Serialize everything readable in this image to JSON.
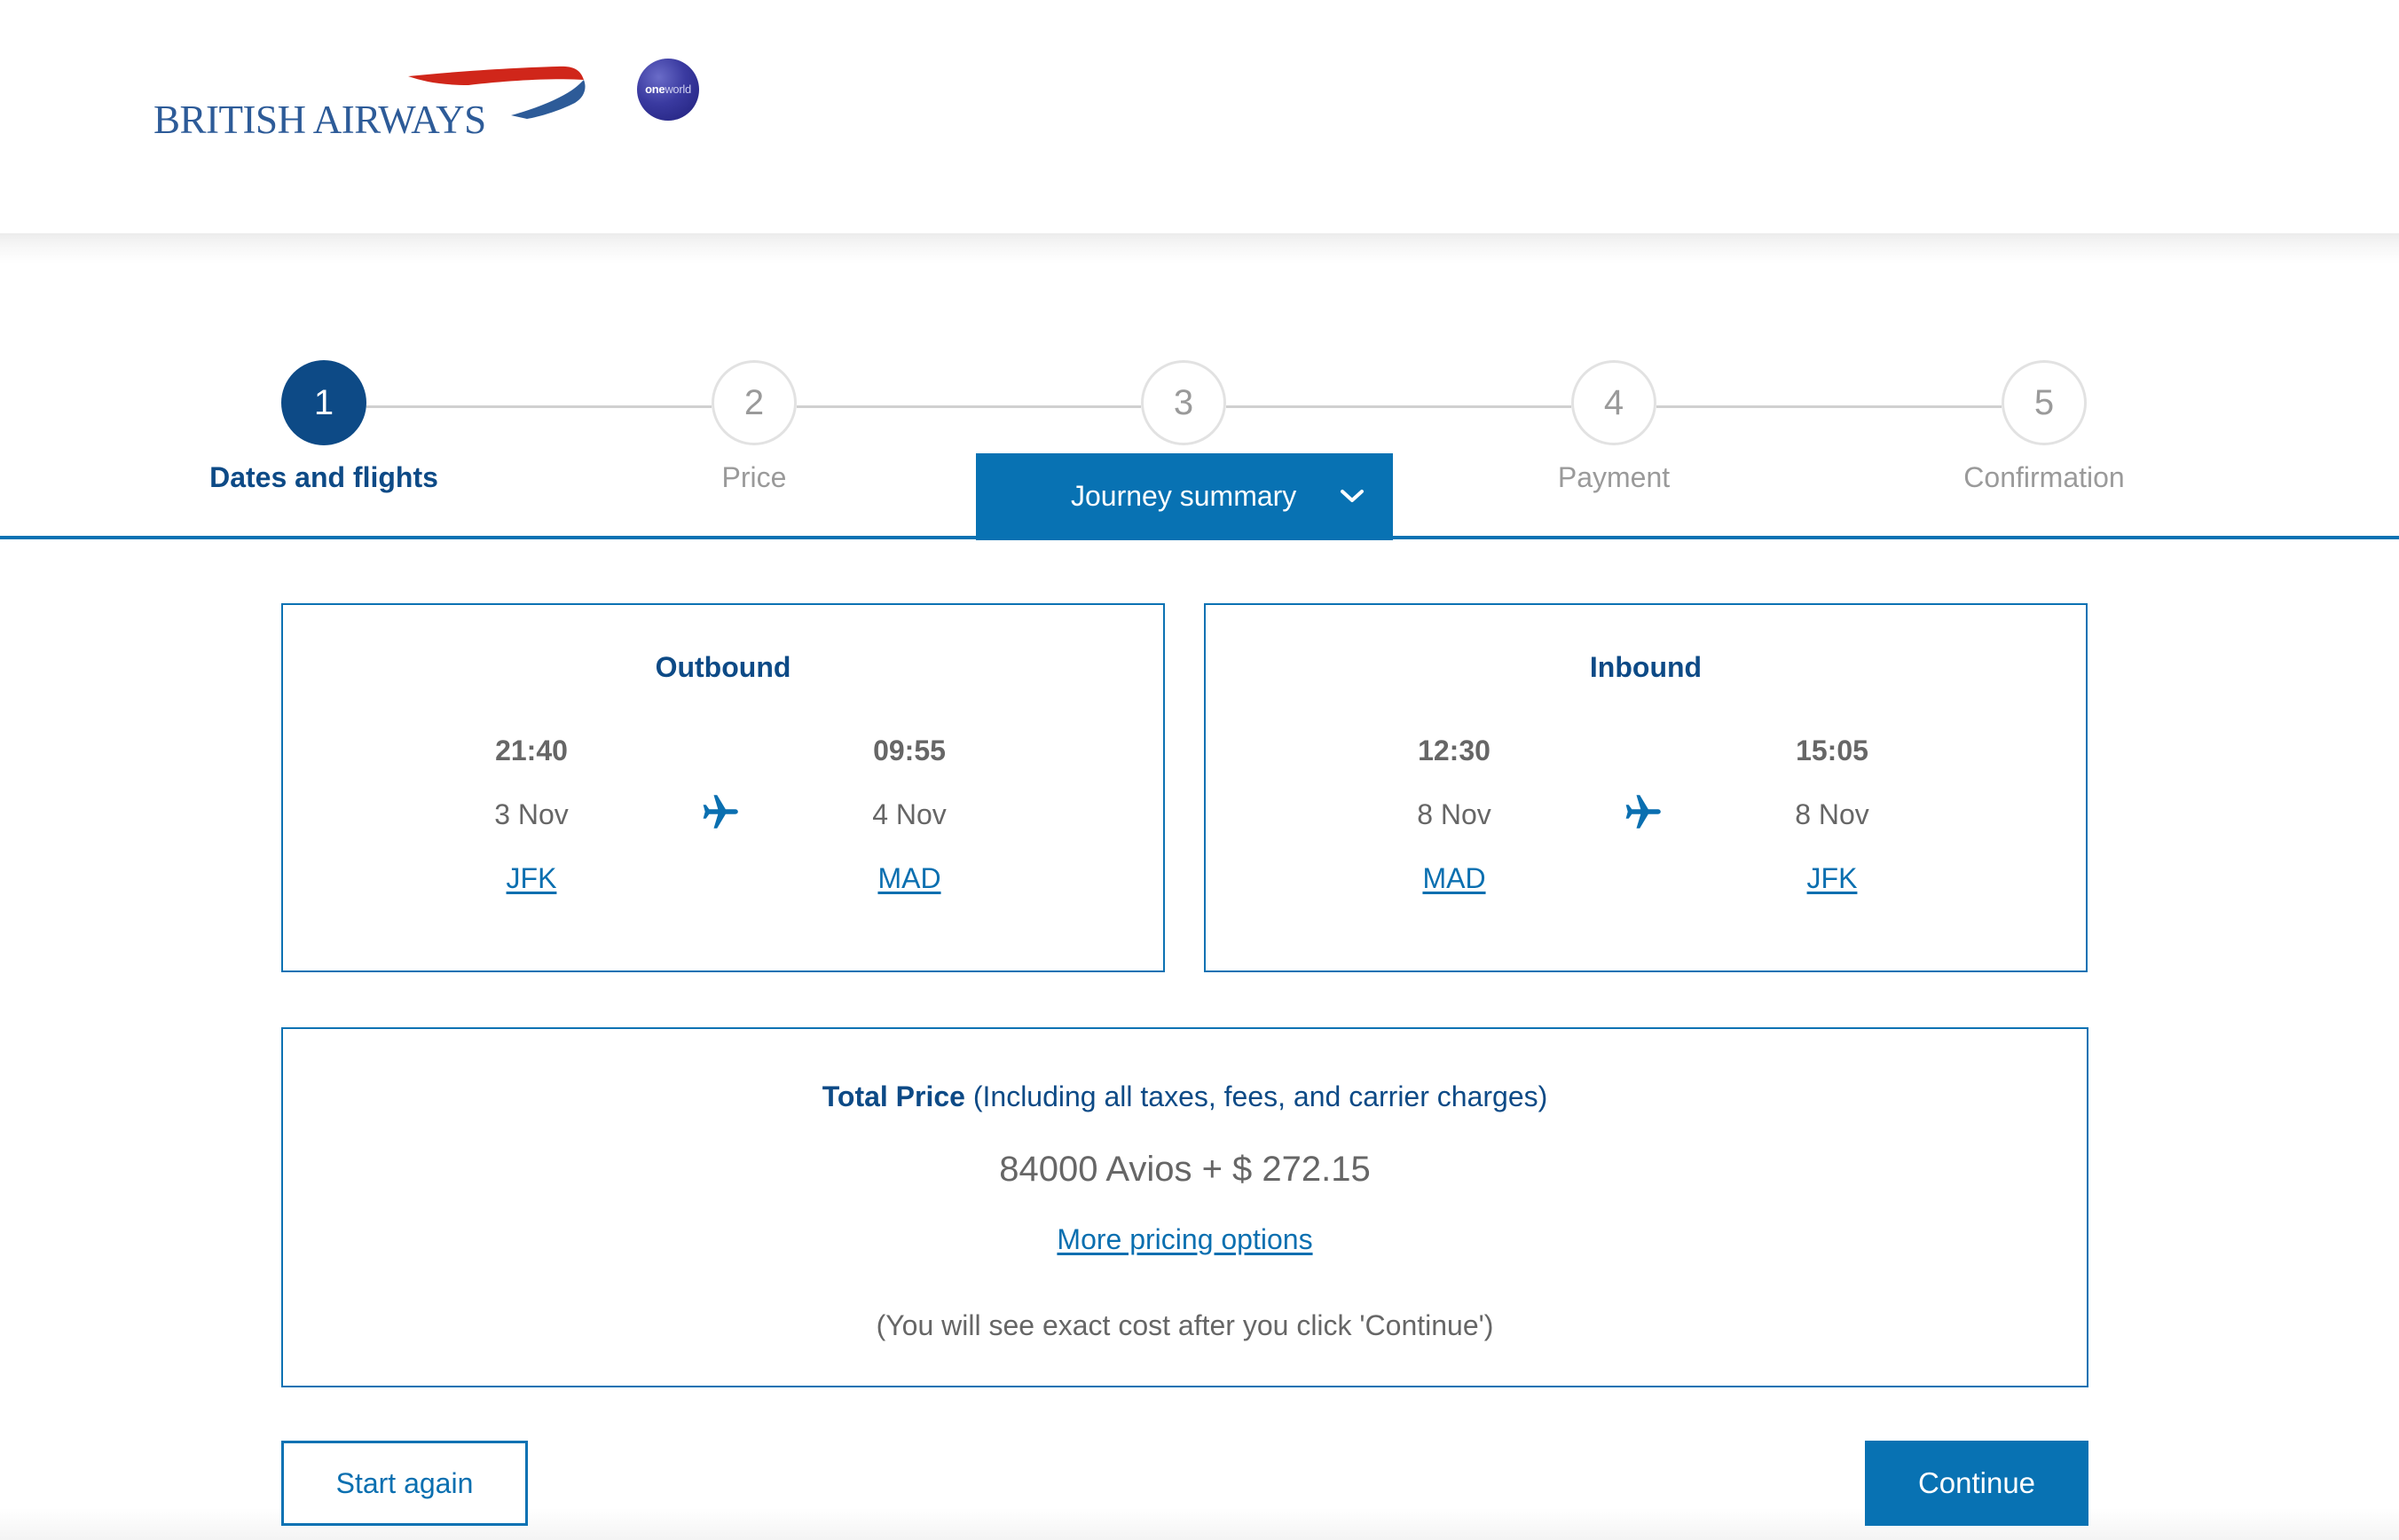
{
  "header": {
    "brand": "BRITISH AIRWAYS",
    "alliance_logo": {
      "bold": "one",
      "light": "world"
    },
    "colors": {
      "brand_blue": "#2d5b98",
      "swoosh_red": "#d0261a"
    }
  },
  "stepper": {
    "current_step": 1,
    "steps": [
      {
        "number": "1",
        "label": "Dates and flights",
        "state": "active"
      },
      {
        "number": "2",
        "label": "Price",
        "state": "upcoming"
      },
      {
        "number": "3",
        "label": "Journey summary",
        "state": "upcoming"
      },
      {
        "number": "4",
        "label": "Payment",
        "state": "upcoming"
      },
      {
        "number": "5",
        "label": "Confirmation",
        "state": "upcoming"
      }
    ],
    "journey_summary_tab": {
      "label": "Journey summary",
      "icon": "chevron-down-icon",
      "expanded": true
    }
  },
  "outbound": {
    "title": "Outbound",
    "departure": {
      "time": "21:40",
      "date": "3 Nov",
      "airport": "JFK"
    },
    "arrival": {
      "time": "09:55",
      "date": "4 Nov",
      "airport": "MAD"
    },
    "icon": "plane-icon"
  },
  "inbound": {
    "title": "Inbound",
    "departure": {
      "time": "12:30",
      "date": "8 Nov",
      "airport": "MAD"
    },
    "arrival": {
      "time": "15:05",
      "date": "8 Nov",
      "airport": "JFK"
    },
    "icon": "plane-icon"
  },
  "price": {
    "title_bold": "Total Price",
    "title_note": "(Including all taxes, fees, and carrier charges)",
    "value": "84000 Avios + $ 272.15",
    "more_options_link": "More pricing options",
    "note": "(You will see exact cost after you click 'Continue')"
  },
  "actions": {
    "start_again": "Start again",
    "continue": "Continue"
  },
  "theme": {
    "primary": "#0872b3",
    "dark_blue": "#0d4a86",
    "text_gray": "#666666",
    "inactive_gray": "#9a9a9a"
  }
}
